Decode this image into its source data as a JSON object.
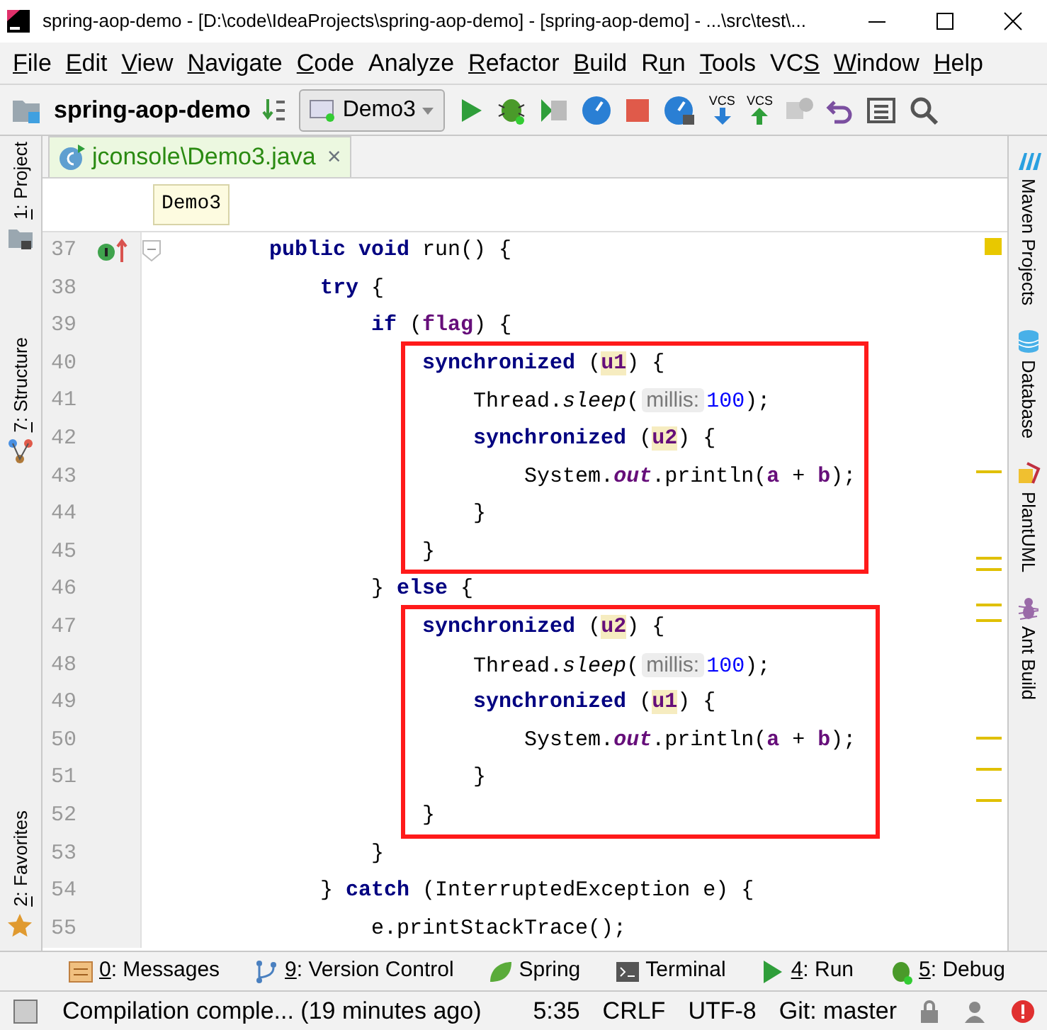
{
  "window": {
    "title": "spring-aop-demo - [D:\\code\\IdeaProjects\\spring-aop-demo] - [spring-aop-demo] - ...\\src\\test\\..."
  },
  "menu": [
    {
      "key": "F",
      "post": "ile"
    },
    {
      "key": "E",
      "post": "dit"
    },
    {
      "key": "V",
      "post": "iew"
    },
    {
      "key": "N",
      "post": "avigate"
    },
    {
      "key": "C",
      "post": "ode"
    },
    {
      "pre": "Analyze"
    },
    {
      "key": "R",
      "post": "efactor"
    },
    {
      "key": "B",
      "post": "uild"
    },
    {
      "pre": "R",
      "key": "u",
      "post": "n"
    },
    {
      "key": "T",
      "post": "ools"
    },
    {
      "pre": "VC",
      "key": "S"
    },
    {
      "key": "W",
      "post": "indow"
    },
    {
      "key": "H",
      "post": "elp"
    }
  ],
  "toolbar": {
    "project": "spring-aop-demo",
    "run_config": "Demo3",
    "vcs_update_caption": "VCS",
    "vcs_commit_caption": "VCS"
  },
  "left_tools": [
    {
      "key": "1",
      "post": ": Project",
      "kind": "project"
    },
    {
      "key": "7",
      "post": ": Structure",
      "kind": "structure"
    },
    {
      "key": "2",
      "post": ": Favorites",
      "kind": "favorites"
    }
  ],
  "right_tools": [
    {
      "label": "Maven Projects",
      "kind": "maven"
    },
    {
      "label": "Database",
      "kind": "database"
    },
    {
      "label": "PlantUML",
      "kind": "plantuml"
    },
    {
      "label": "Ant Build",
      "kind": "ant"
    }
  ],
  "tabs": [
    {
      "label": "jconsole\\Demo3.java",
      "selected": true,
      "close": "×"
    }
  ],
  "breadcrumb": "Demo3",
  "editor": {
    "blocks": [
      {
        "kind": "line",
        "number": "37",
        "fold": true,
        "implements": true,
        "tokens": [
          {
            "text": "        public void ",
            "kind": "kw"
          },
          {
            "text": "run() {",
            "kind": "p"
          }
        ]
      },
      {
        "kind": "line",
        "number": "38",
        "tokens": [
          {
            "text": "            try ",
            "kind": "kw"
          },
          {
            "text": "{",
            "kind": "p"
          }
        ]
      },
      {
        "kind": "line",
        "number": "39",
        "tokens": [
          {
            "text": "                if ",
            "kind": "kw"
          },
          {
            "text": "(",
            "kind": "p"
          },
          {
            "text": "flag",
            "kind": "field"
          },
          {
            "text": ") {",
            "kind": "p"
          }
        ]
      },
      {
        "kind": "box",
        "lines": [
          {
            "number": "40",
            "tokens": [
              {
                "text": "                    synchronized ",
                "kind": "kw"
              },
              {
                "text": "(",
                "kind": "p"
              },
              {
                "text": "u1",
                "kind": "lock"
              },
              {
                "text": ") {",
                "kind": "p"
              }
            ]
          },
          {
            "number": "41",
            "tokens": [
              {
                "text": "                        Thread.",
                "kind": "p"
              },
              {
                "text": "sleep",
                "kind": "italic"
              },
              {
                "text": "(",
                "kind": "p"
              },
              {
                "text": "millis:",
                "kind": "hint"
              },
              {
                "text": "100",
                "kind": "num"
              },
              {
                "text": ");",
                "kind": "p"
              }
            ]
          },
          {
            "number": "42",
            "tokens": [
              {
                "text": "                        synchronized ",
                "kind": "kw"
              },
              {
                "text": "(",
                "kind": "p"
              },
              {
                "text": "u2",
                "kind": "lock"
              },
              {
                "text": ") {",
                "kind": "p"
              }
            ]
          },
          {
            "number": "43",
            "tokens": [
              {
                "text": "                            System.",
                "kind": "p"
              },
              {
                "text": "out",
                "kind": "static"
              },
              {
                "text": ".println(",
                "kind": "p"
              },
              {
                "text": "a",
                "kind": "field"
              },
              {
                "text": " + ",
                "kind": "p"
              },
              {
                "text": "b",
                "kind": "field"
              },
              {
                "text": ");",
                "kind": "p"
              }
            ]
          },
          {
            "number": "44",
            "tokens": [
              {
                "text": "                        }",
                "kind": "p"
              }
            ]
          },
          {
            "number": "45",
            "tokens": [
              {
                "text": "                    }",
                "kind": "p"
              }
            ]
          }
        ]
      },
      {
        "kind": "line",
        "number": "46",
        "tokens": [
          {
            "text": "                } ",
            "kind": "p"
          },
          {
            "text": "else ",
            "kind": "kw"
          },
          {
            "text": "{",
            "kind": "p"
          }
        ]
      },
      {
        "kind": "box",
        "lines": [
          {
            "number": "47",
            "tokens": [
              {
                "text": "                    synchronized ",
                "kind": "kw"
              },
              {
                "text": "(",
                "kind": "p"
              },
              {
                "text": "u2",
                "kind": "lock"
              },
              {
                "text": ") {",
                "kind": "p"
              }
            ]
          },
          {
            "number": "48",
            "tokens": [
              {
                "text": "                        Thread.",
                "kind": "p"
              },
              {
                "text": "sleep",
                "kind": "italic"
              },
              {
                "text": "(",
                "kind": "p"
              },
              {
                "text": "millis:",
                "kind": "hint"
              },
              {
                "text": "100",
                "kind": "num"
              },
              {
                "text": ");",
                "kind": "p"
              }
            ]
          },
          {
            "number": "49",
            "tokens": [
              {
                "text": "                        synchronized ",
                "kind": "kw"
              },
              {
                "text": "(",
                "kind": "p"
              },
              {
                "text": "u1",
                "kind": "lock"
              },
              {
                "text": ") {",
                "kind": "p"
              }
            ]
          },
          {
            "number": "50",
            "tokens": [
              {
                "text": "                            System.",
                "kind": "p"
              },
              {
                "text": "out",
                "kind": "static"
              },
              {
                "text": ".println(",
                "kind": "p"
              },
              {
                "text": "a",
                "kind": "field"
              },
              {
                "text": " + ",
                "kind": "p"
              },
              {
                "text": "b",
                "kind": "field"
              },
              {
                "text": ");",
                "kind": "p"
              }
            ]
          },
          {
            "number": "51",
            "tokens": [
              {
                "text": "                        }",
                "kind": "p"
              }
            ]
          },
          {
            "number": "52",
            "tokens": [
              {
                "text": "                    }",
                "kind": "p"
              }
            ]
          }
        ]
      },
      {
        "kind": "line",
        "number": "53",
        "tokens": [
          {
            "text": "                }",
            "kind": "p"
          }
        ]
      },
      {
        "kind": "line",
        "number": "54",
        "tokens": [
          {
            "text": "            } ",
            "kind": "p"
          },
          {
            "text": "catch ",
            "kind": "kw"
          },
          {
            "text": "(InterruptedException e) {",
            "kind": "p"
          }
        ]
      },
      {
        "kind": "line",
        "number": "55",
        "tokens": [
          {
            "text": "                e.printStackTrace();",
            "kind": "p"
          }
        ]
      }
    ]
  },
  "bottom_tools": [
    {
      "key": "0",
      "post": ": Messages",
      "kind": "messages"
    },
    {
      "key": "9",
      "post": ": Version Control",
      "kind": "vcs"
    },
    {
      "pre": "Spring",
      "kind": "spring"
    },
    {
      "pre": "Terminal",
      "kind": "terminal"
    },
    {
      "key": "4",
      "post": ": Run",
      "kind": "run"
    },
    {
      "key": "5",
      "post": ": Debug",
      "kind": "debug"
    }
  ],
  "status_bar": {
    "message": "Compilation comple... (19 minutes ago)",
    "position": "5:35",
    "line_separator": "CRLF",
    "encoding": "UTF-8",
    "vcs_branch": "Git: master"
  }
}
